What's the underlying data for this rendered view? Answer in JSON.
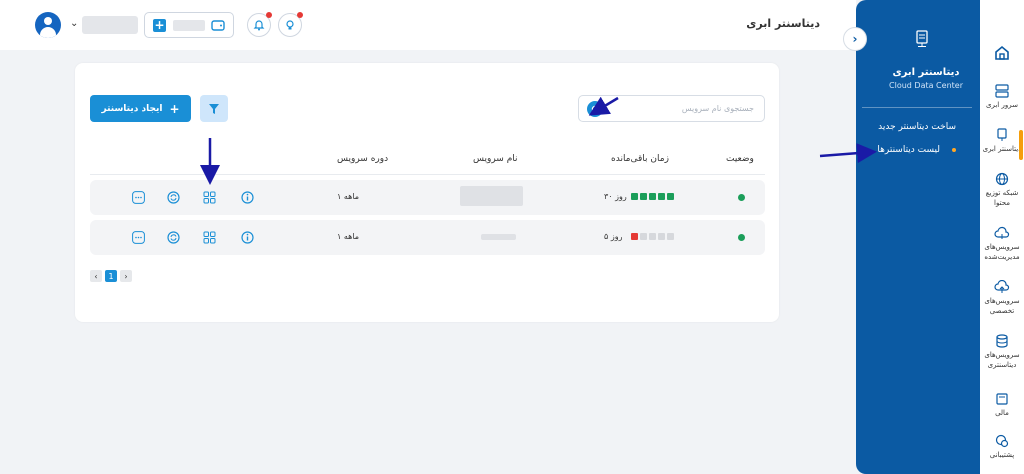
{
  "header": {
    "title": "دیتاسنتر ابری"
  },
  "panel": {
    "title": "دیتاسنتر ابری",
    "subtitle": "Cloud Data Center",
    "links": [
      "ساخت دیتاسنتر جدید",
      "لیست دیتاسنترها"
    ]
  },
  "rail": {
    "items": [
      {
        "label": "",
        "icon": "home-icon"
      },
      {
        "label": "سرور ابری",
        "icon": "server-icon"
      },
      {
        "label": "دیتاسنتر ابری",
        "icon": "datacenter-icon"
      },
      {
        "label": "شبکه توزیع محتوا",
        "icon": "globe-icon"
      },
      {
        "label": "سرویس‌های مدیریت‌شده",
        "icon": "cloud-settings-icon"
      },
      {
        "label": "سرویس‌های تخصصی",
        "icon": "cloud-upload-icon"
      },
      {
        "label": "سرویس‌های دیتاسنتری",
        "icon": "database-icon"
      },
      {
        "label": "مالی",
        "icon": "wallet-icon"
      },
      {
        "label": "پشتیبانی",
        "icon": "support-icon"
      }
    ]
  },
  "toolbar": {
    "create_label": "ایجاد دیتاسنتر",
    "search_placeholder": "جستجوی نام سرویس"
  },
  "table": {
    "headers": {
      "status": "وضعیت",
      "remaining": "زمان باقی‌مانده",
      "name": "نام سرویس",
      "period": "دوره سرویس"
    },
    "rows": [
      {
        "status": "active",
        "remaining": "۳۰ روز",
        "blocks": [
          "#1b9e5a",
          "#1b9e5a",
          "#1b9e5a",
          "#1b9e5a",
          "#1b9e5a"
        ],
        "period": "۱ ماهه"
      },
      {
        "status": "active",
        "remaining": "۵ روز",
        "blocks": [
          "#e53935",
          "#d6d8dc",
          "#d6d8dc",
          "#d6d8dc",
          "#d6d8dc"
        ],
        "period": "۱ ماهه"
      }
    ]
  },
  "pagination": {
    "current": "1",
    "prev": "‹",
    "next": "›"
  },
  "colors": {
    "primary": "#1a8fd6",
    "panel": "#0b5aa3",
    "success": "#1b9e5a",
    "danger": "#e53935",
    "annotation": "#1a1aa6"
  }
}
